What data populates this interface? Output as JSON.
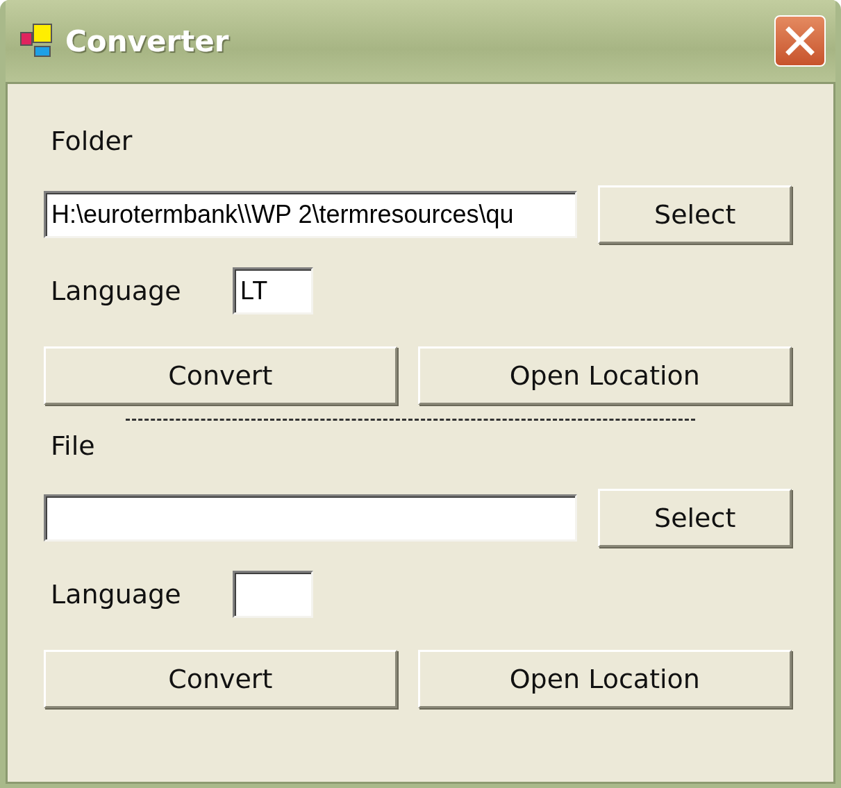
{
  "window": {
    "title": "Converter"
  },
  "sections": [
    {
      "label": "Folder",
      "path": "H:\\eurotermbank\\\\WP 2\\termresources\\qu",
      "select_button": "Select",
      "language_label": "Language",
      "language": "LT",
      "convert_button": "Convert",
      "open_button": "Open Location"
    },
    {
      "label": "File",
      "select_button": "Select",
      "language_label": "Language",
      "convert_button": "Convert",
      "open_button": "Open Location"
    }
  ]
}
